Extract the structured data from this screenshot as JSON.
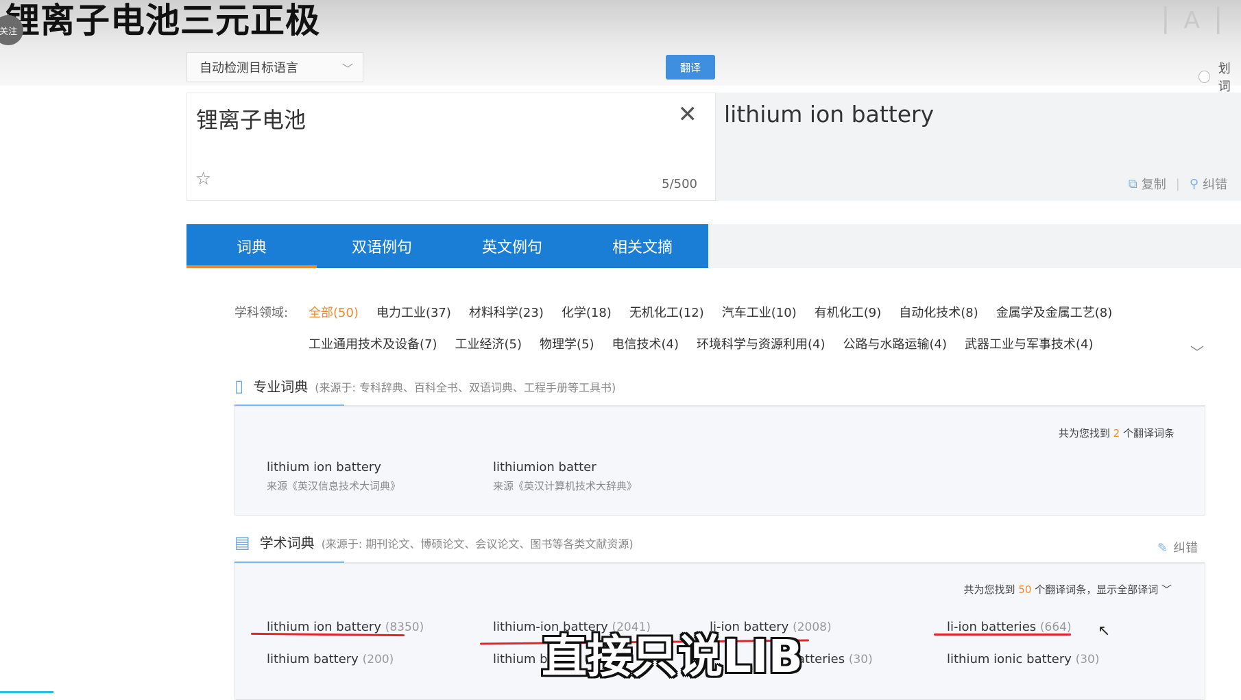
{
  "video": {
    "title": "锂离子电池三元正极",
    "follow": "关注",
    "subtitle": "直接只说LIB"
  },
  "toolbar": {
    "lang_select": "自动检测目标语言",
    "translate_button": "翻译",
    "huaci": "划词"
  },
  "source": {
    "text": "锂离子电池",
    "count": "5/500"
  },
  "output": {
    "text": "lithium ion battery",
    "copy": "复制",
    "report": "纠错"
  },
  "tabs": [
    {
      "label": "词典"
    },
    {
      "label": "双语例句"
    },
    {
      "label": "英文例句"
    },
    {
      "label": "相关文摘"
    }
  ],
  "subjects": {
    "label": "学科领域:",
    "row1": [
      "全部(50)",
      "电力工业(37)",
      "材料科学(23)",
      "化学(18)",
      "无机化工(12)",
      "汽车工业(10)",
      "有机化工(9)",
      "自动化技术(8)",
      "金属学及金属工艺(8)"
    ],
    "row2": [
      "工业通用技术及设备(7)",
      "工业经济(5)",
      "物理学(5)",
      "电信技术(4)",
      "环境科学与资源利用(4)",
      "公路与水路运输(4)",
      "武器工业与军事技术(4)"
    ]
  },
  "pro_dict": {
    "title": "专业词典",
    "desc": "(来源于: 专科辞典、百科全书、双语词典、工程手册等工具书)",
    "found_prefix": "共为您找到",
    "found_num": "2",
    "found_suffix": "个翻译词条",
    "entries": [
      {
        "term": "lithium ion battery",
        "source": "来源《英汉信息技术大词典》"
      },
      {
        "term": "lithiumion batter",
        "source": "来源《英汉计算机技术大辞典》"
      }
    ]
  },
  "acad_dict": {
    "title": "学术词典",
    "desc": "(来源于: 期刊论文、博硕论文、会议论文、图书等各类文献资源)",
    "report": "纠错",
    "found_prefix": "共为您找到",
    "found_num": "50",
    "found_suffix": "个翻译词条，显示全部译词",
    "entries_row1": [
      {
        "term": "lithium ion battery",
        "count": "(8350)"
      },
      {
        "term": "lithium-ion battery",
        "count": "(2041)"
      },
      {
        "term": "li-ion battery",
        "count": "(2008)"
      },
      {
        "term": "li-ion batteries",
        "count": "(664)"
      }
    ],
    "entries_row2": [
      {
        "term": "lithium battery",
        "count": "(200)"
      },
      {
        "term": "lithium b",
        "count": ""
      },
      {
        "term": "atteries",
        "count": "(30)"
      },
      {
        "term": "lithium ionic battery",
        "count": "(30)"
      }
    ]
  },
  "colors": {
    "accent": "#1b7ed6",
    "highlight": "#f08a2c",
    "annotation": "#e0242b"
  }
}
